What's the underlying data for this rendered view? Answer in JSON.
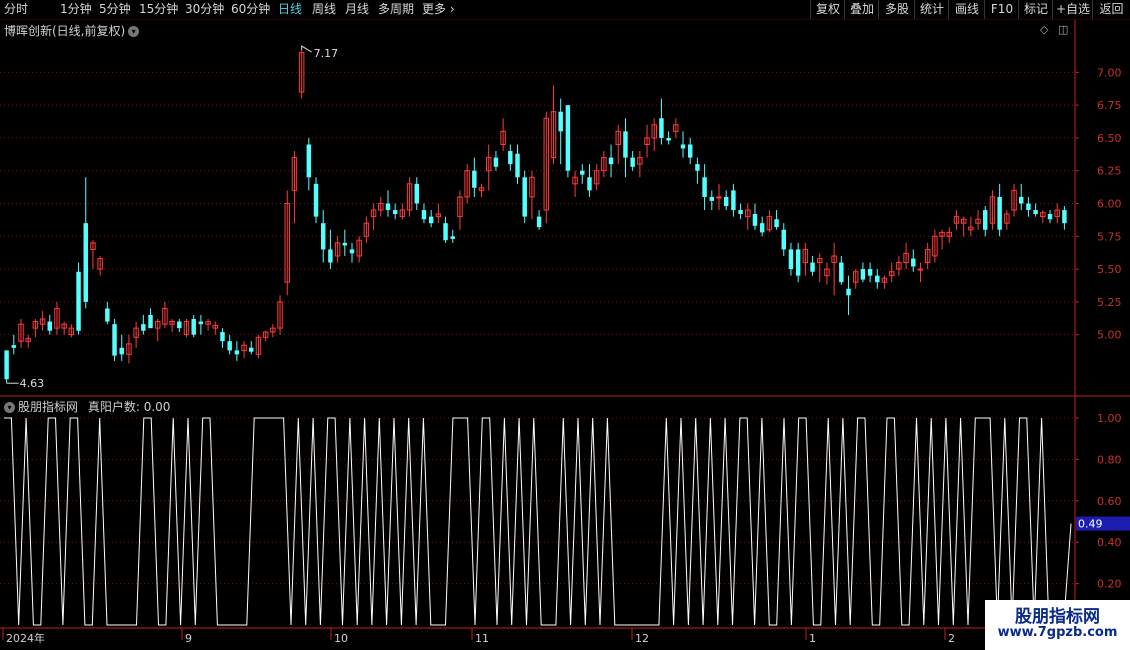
{
  "toolbar": {
    "periods": [
      "分时",
      "1分钟",
      "5分钟",
      "15分钟",
      "30分钟",
      "60分钟",
      "日线",
      "周线",
      "月线",
      "多周期",
      "更多"
    ],
    "active_period": "日线",
    "right_buttons": [
      "复权",
      "叠加",
      "多股",
      "统计",
      "画线",
      "F10",
      "标记",
      "+自选",
      "返回"
    ]
  },
  "price_panel": {
    "title": "博晖创新(日线,前复权)",
    "high_label": "7.17",
    "low_label": "4.63"
  },
  "indicator_panel": {
    "title": "股朋指标网",
    "indicator_name": "真阳户数",
    "indicator_value": "0.00",
    "current_value": "0.49"
  },
  "watermark": {
    "line1": "股朋指标网",
    "line2": "www.7gpzb.com"
  },
  "colors": {
    "up": "#ff3b3b",
    "down": "#54ffff",
    "axis": "#c02020",
    "grid": "#7a1010",
    "indicator_line": "#ffffff",
    "current_value_bg": "#1c1cb0",
    "active_tab": "#4fd2e0"
  },
  "chart_data": [
    {
      "type": "candlestick",
      "title": "博晖创新(日线,前复权)",
      "y_ticks": [
        "7.00",
        "6.75",
        "6.50",
        "6.25",
        "6.00",
        "5.75",
        "5.50",
        "5.25",
        "5.00"
      ],
      "ylim": [
        4.54,
        7.3
      ],
      "x_ticks": [
        "2024年",
        "9",
        "10",
        "11",
        "12",
        "1",
        "2"
      ],
      "annotations": {
        "max": 7.17,
        "min": 4.63
      },
      "ohlc": [
        [
          4.88,
          4.88,
          4.63,
          4.66
        ],
        [
          4.92,
          5.0,
          4.85,
          4.9
        ],
        [
          4.95,
          5.12,
          4.9,
          5.08
        ],
        [
          4.95,
          5.0,
          4.9,
          4.97
        ],
        [
          5.05,
          5.12,
          4.98,
          5.1
        ],
        [
          5.08,
          5.18,
          5.03,
          5.12
        ],
        [
          5.1,
          5.15,
          5.0,
          5.03
        ],
        [
          5.05,
          5.25,
          5.0,
          5.2
        ],
        [
          5.05,
          5.1,
          5.0,
          5.08
        ],
        [
          5.0,
          5.08,
          4.98,
          5.05
        ],
        [
          5.48,
          5.55,
          5.0,
          5.03
        ],
        [
          5.85,
          6.2,
          5.2,
          5.25
        ],
        [
          5.65,
          5.72,
          5.5,
          5.7
        ],
        [
          5.5,
          5.6,
          5.45,
          5.58
        ],
        [
          5.2,
          5.25,
          5.08,
          5.1
        ],
        [
          5.08,
          5.12,
          4.8,
          4.84
        ],
        [
          4.9,
          5.0,
          4.8,
          4.85
        ],
        [
          4.85,
          5.0,
          4.78,
          4.93
        ],
        [
          4.98,
          5.1,
          4.9,
          5.05
        ],
        [
          5.08,
          5.15,
          5.0,
          5.03
        ],
        [
          5.15,
          5.2,
          5.05,
          5.05
        ],
        [
          5.05,
          5.12,
          4.95,
          5.1
        ],
        [
          5.08,
          5.25,
          5.05,
          5.2
        ],
        [
          5.08,
          5.12,
          5.02,
          5.1
        ],
        [
          5.1,
          5.12,
          5.02,
          5.05
        ],
        [
          5.0,
          5.12,
          4.98,
          5.1
        ],
        [
          5.12,
          5.15,
          4.98,
          5.0
        ],
        [
          5.1,
          5.15,
          5.0,
          5.08
        ],
        [
          5.08,
          5.12,
          5.03,
          5.1
        ],
        [
          5.05,
          5.1,
          5.0,
          5.07
        ],
        [
          5.02,
          5.05,
          4.9,
          4.95
        ],
        [
          4.95,
          5.0,
          4.85,
          4.88
        ],
        [
          4.88,
          4.95,
          4.8,
          4.85
        ],
        [
          4.88,
          4.95,
          4.82,
          4.92
        ],
        [
          4.9,
          4.95,
          4.85,
          4.87
        ],
        [
          4.85,
          5.0,
          4.82,
          4.98
        ],
        [
          4.98,
          5.03,
          4.95,
          5.02
        ],
        [
          5.02,
          5.08,
          4.98,
          5.05
        ],
        [
          5.05,
          5.3,
          5.0,
          5.25
        ],
        [
          5.4,
          6.1,
          5.3,
          6.0
        ],
        [
          6.1,
          6.4,
          5.85,
          6.35
        ],
        [
          6.85,
          7.17,
          6.8,
          7.15
        ],
        [
          6.45,
          6.5,
          6.1,
          6.2
        ],
        [
          6.15,
          6.2,
          5.85,
          5.9
        ],
        [
          5.85,
          5.95,
          5.55,
          5.65
        ],
        [
          5.65,
          5.8,
          5.5,
          5.55
        ],
        [
          5.6,
          5.75,
          5.55,
          5.7
        ],
        [
          5.7,
          5.8,
          5.6,
          5.68
        ],
        [
          5.65,
          5.7,
          5.55,
          5.62
        ],
        [
          5.6,
          5.75,
          5.55,
          5.72
        ],
        [
          5.75,
          5.9,
          5.7,
          5.85
        ],
        [
          5.9,
          6.0,
          5.8,
          5.95
        ],
        [
          5.95,
          6.05,
          5.9,
          6.0
        ],
        [
          6.0,
          6.1,
          5.9,
          5.95
        ],
        [
          5.95,
          6.0,
          5.88,
          5.92
        ],
        [
          5.9,
          6.0,
          5.88,
          5.95
        ],
        [
          5.95,
          6.2,
          5.9,
          6.15
        ],
        [
          6.15,
          6.2,
          5.95,
          6.0
        ],
        [
          5.95,
          6.0,
          5.85,
          5.88
        ],
        [
          5.9,
          5.95,
          5.82,
          5.85
        ],
        [
          5.9,
          6.0,
          5.85,
          5.92
        ],
        [
          5.85,
          5.9,
          5.7,
          5.72
        ],
        [
          5.75,
          5.8,
          5.7,
          5.73
        ],
        [
          5.9,
          6.1,
          5.8,
          6.05
        ],
        [
          6.05,
          6.3,
          6.0,
          6.25
        ],
        [
          6.25,
          6.35,
          6.05,
          6.12
        ],
        [
          6.1,
          6.15,
          6.05,
          6.12
        ],
        [
          6.25,
          6.45,
          6.1,
          6.35
        ],
        [
          6.35,
          6.4,
          6.25,
          6.28
        ],
        [
          6.45,
          6.65,
          6.4,
          6.55
        ],
        [
          6.4,
          6.45,
          6.25,
          6.3
        ],
        [
          6.38,
          6.45,
          6.15,
          6.2
        ],
        [
          6.2,
          6.25,
          5.85,
          5.9
        ],
        [
          6.05,
          6.25,
          5.88,
          6.2
        ],
        [
          5.9,
          5.95,
          5.8,
          5.82
        ],
        [
          5.95,
          6.7,
          5.85,
          6.65
        ],
        [
          6.35,
          6.9,
          6.3,
          6.7
        ],
        [
          6.7,
          6.8,
          6.3,
          6.55
        ],
        [
          6.75,
          6.75,
          6.2,
          6.25
        ],
        [
          6.15,
          6.25,
          6.05,
          6.2
        ],
        [
          6.25,
          6.3,
          6.15,
          6.22
        ],
        [
          6.2,
          6.3,
          6.05,
          6.1
        ],
        [
          6.15,
          6.3,
          6.1,
          6.25
        ],
        [
          6.25,
          6.4,
          6.2,
          6.35
        ],
        [
          6.35,
          6.45,
          6.2,
          6.3
        ],
        [
          6.45,
          6.6,
          6.3,
          6.55
        ],
        [
          6.55,
          6.65,
          6.2,
          6.35
        ],
        [
          6.35,
          6.4,
          6.25,
          6.28
        ],
        [
          6.3,
          6.4,
          6.2,
          6.35
        ],
        [
          6.45,
          6.6,
          6.35,
          6.5
        ],
        [
          6.5,
          6.65,
          6.4,
          6.6
        ],
        [
          6.65,
          6.8,
          6.45,
          6.5
        ],
        [
          6.5,
          6.55,
          6.45,
          6.48
        ],
        [
          6.55,
          6.65,
          6.5,
          6.6
        ],
        [
          6.45,
          6.55,
          6.35,
          6.42
        ],
        [
          6.45,
          6.5,
          6.3,
          6.35
        ],
        [
          6.3,
          6.35,
          6.15,
          6.25
        ],
        [
          6.2,
          6.3,
          5.95,
          6.05
        ],
        [
          6.05,
          6.1,
          5.95,
          6.02
        ],
        [
          6.05,
          6.15,
          5.95,
          6.05
        ],
        [
          6.05,
          6.1,
          5.95,
          5.98
        ],
        [
          6.1,
          6.15,
          5.9,
          5.95
        ],
        [
          5.95,
          6.0,
          5.88,
          5.92
        ],
        [
          5.9,
          6.0,
          5.8,
          5.95
        ],
        [
          5.92,
          6.0,
          5.8,
          5.83
        ],
        [
          5.85,
          5.9,
          5.75,
          5.78
        ],
        [
          5.8,
          5.95,
          5.78,
          5.9
        ],
        [
          5.88,
          5.95,
          5.8,
          5.82
        ],
        [
          5.8,
          5.85,
          5.6,
          5.65
        ],
        [
          5.65,
          5.7,
          5.45,
          5.5
        ],
        [
          5.65,
          5.7,
          5.4,
          5.45
        ],
        [
          5.55,
          5.7,
          5.45,
          5.65
        ],
        [
          5.55,
          5.6,
          5.45,
          5.48
        ],
        [
          5.55,
          5.62,
          5.4,
          5.58
        ],
        [
          5.45,
          5.55,
          5.38,
          5.5
        ],
        [
          5.55,
          5.7,
          5.3,
          5.6
        ],
        [
          5.55,
          5.6,
          5.38,
          5.4
        ],
        [
          5.35,
          5.45,
          5.15,
          5.3
        ],
        [
          5.4,
          5.5,
          5.35,
          5.48
        ],
        [
          5.5,
          5.55,
          5.4,
          5.42
        ],
        [
          5.5,
          5.55,
          5.4,
          5.45
        ],
        [
          5.45,
          5.5,
          5.35,
          5.4
        ],
        [
          5.4,
          5.45,
          5.35,
          5.43
        ],
        [
          5.45,
          5.55,
          5.4,
          5.48
        ],
        [
          5.5,
          5.6,
          5.45,
          5.55
        ],
        [
          5.55,
          5.7,
          5.5,
          5.62
        ],
        [
          5.58,
          5.65,
          5.48,
          5.52
        ],
        [
          5.5,
          5.55,
          5.4,
          5.5
        ],
        [
          5.55,
          5.7,
          5.5,
          5.65
        ],
        [
          5.6,
          5.8,
          5.55,
          5.75
        ],
        [
          5.75,
          5.8,
          5.65,
          5.78
        ],
        [
          5.75,
          5.82,
          5.7,
          5.78
        ],
        [
          5.85,
          5.95,
          5.8,
          5.9
        ],
        [
          5.85,
          5.9,
          5.75,
          5.88
        ],
        [
          5.8,
          5.9,
          5.75,
          5.82
        ],
        [
          5.85,
          5.95,
          5.8,
          5.88
        ],
        [
          5.95,
          5.98,
          5.75,
          5.8
        ],
        [
          5.85,
          6.1,
          5.8,
          6.05
        ],
        [
          6.05,
          6.15,
          5.75,
          5.8
        ],
        [
          5.85,
          5.95,
          5.8,
          5.92
        ],
        [
          5.95,
          6.15,
          5.9,
          6.1
        ],
        [
          6.05,
          6.15,
          5.95,
          6.0
        ],
        [
          6.0,
          6.05,
          5.9,
          5.95
        ],
        [
          5.95,
          6.0,
          5.9,
          5.92
        ],
        [
          5.9,
          5.95,
          5.85,
          5.93
        ],
        [
          5.92,
          5.95,
          5.85,
          5.88
        ],
        [
          5.9,
          6.0,
          5.85,
          5.95
        ],
        [
          5.95,
          5.98,
          5.8,
          5.85
        ]
      ]
    },
    {
      "type": "line",
      "title": "真阳户数",
      "y_ticks": [
        "1.00",
        "0.80",
        "0.60",
        "0.40",
        "0.20"
      ],
      "ylim": [
        0,
        1.05
      ],
      "values": [
        1,
        1,
        0,
        1,
        0,
        0,
        1,
        1,
        0,
        1,
        1,
        0,
        0,
        1,
        0,
        0,
        0,
        0,
        0,
        1,
        1,
        0,
        0,
        1,
        0,
        1,
        0,
        1,
        1,
        0,
        0,
        0,
        0,
        0,
        1,
        1,
        1,
        1,
        1,
        0,
        1,
        0,
        1,
        0,
        1,
        1,
        0,
        1,
        0,
        1,
        0,
        1,
        0,
        1,
        0,
        1,
        0,
        1,
        0,
        0,
        0,
        1,
        1,
        1,
        0,
        1,
        1,
        0,
        1,
        0,
        1,
        0,
        1,
        0,
        0,
        0,
        1,
        0,
        1,
        0,
        1,
        0,
        1,
        0,
        0,
        0,
        0,
        0,
        0,
        0,
        1,
        0,
        1,
        0,
        1,
        0,
        1,
        0,
        1,
        0,
        1,
        1,
        0,
        1,
        0,
        0,
        1,
        0,
        1,
        1,
        0,
        0,
        1,
        0,
        1,
        0,
        1,
        1,
        0,
        0,
        1,
        1,
        0,
        0,
        1,
        0,
        1,
        0,
        1,
        0,
        1,
        0,
        1,
        1,
        1,
        0,
        1,
        0,
        1,
        1,
        0,
        1,
        0,
        0,
        0,
        0.49
      ]
    }
  ]
}
